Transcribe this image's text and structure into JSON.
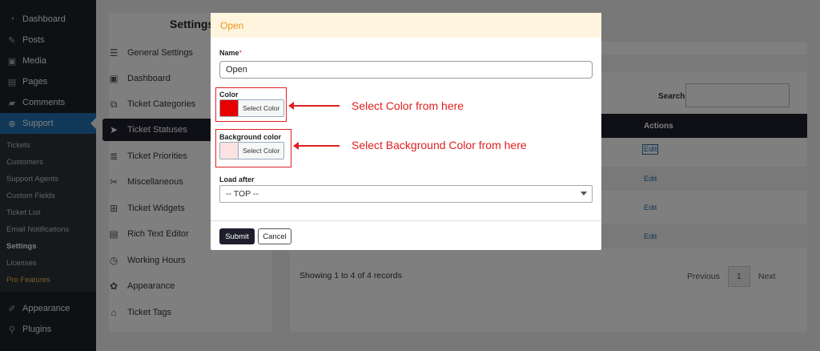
{
  "wp_menu": {
    "items": [
      {
        "label": "Dashboard",
        "icon": "gauge-icon"
      },
      {
        "label": "Posts",
        "icon": "pin-icon"
      },
      {
        "label": "Media",
        "icon": "media-icon"
      },
      {
        "label": "Pages",
        "icon": "page-icon"
      },
      {
        "label": "Comments",
        "icon": "comment-icon"
      },
      {
        "label": "Support",
        "icon": "support-icon"
      }
    ],
    "submenu": [
      "Tickets",
      "Customers",
      "Support Agents",
      "Custom Fields",
      "Ticket List",
      "Email Notifications",
      "Settings",
      "Licenses",
      "Pro Features"
    ],
    "bottom_items": [
      {
        "label": "Appearance",
        "icon": "brush-icon"
      },
      {
        "label": "Plugins",
        "icon": "plug-icon"
      }
    ]
  },
  "settings": {
    "title": "Settings",
    "items": [
      "General Settings",
      "Dashboard",
      "Ticket Categories",
      "Ticket Statuses",
      "Ticket Priorities",
      "Miscellaneous",
      "Ticket Widgets",
      "Rich Text Editor",
      "Working Hours",
      "Appearance",
      "Ticket Tags"
    ]
  },
  "table": {
    "search_label": "Search:",
    "actions_header": "Actions",
    "edit_label": "Edit",
    "showing": "Showing 1 to 4 of 4 records",
    "prev": "Previous",
    "page": "1",
    "next": "Next"
  },
  "modal": {
    "title": "Open",
    "name_label": "Name",
    "name_required_mark": "*",
    "name_value": "Open",
    "color_label": "Color",
    "color_value": "#e60000",
    "bg_color_label": "Background color",
    "bg_color_value": "#fde2e2",
    "select_color_label": "Select Color",
    "load_after_label": "Load after",
    "load_after_value": "-- TOP --",
    "submit_label": "Submit",
    "cancel_label": "Cancel"
  },
  "annotations": {
    "color_note": "Select Color from here",
    "bg_color_note": "Select Background Color from here"
  },
  "colors": {
    "accent_dark": "#1e1e2d",
    "modal_header_bg": "#fff4dd",
    "modal_title": "#e8941a",
    "annotation_red": "#e02020"
  }
}
